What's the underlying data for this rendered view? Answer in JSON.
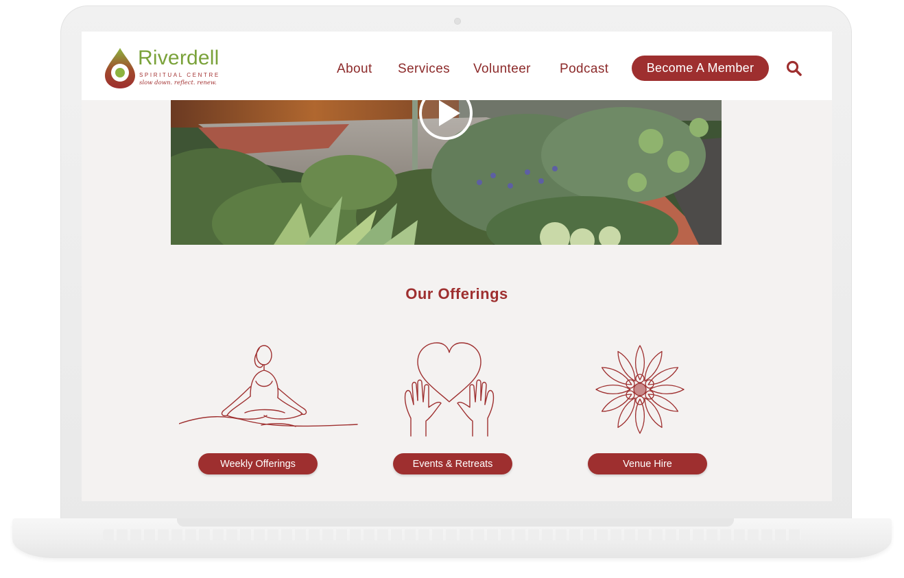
{
  "brand": {
    "name": "Riverdell",
    "subtitle": "SPIRITUAL CENTRE",
    "tagline": "slow down. reflect. renew."
  },
  "nav": {
    "items": [
      {
        "label": "About"
      },
      {
        "label": "Services"
      },
      {
        "label": "Volunteer"
      },
      {
        "label": "Podcast"
      }
    ],
    "cta_label": "Become A Member",
    "search_icon": "search-icon"
  },
  "hero": {
    "play_icon": "play-icon"
  },
  "offerings": {
    "title": "Our Offerings",
    "items": [
      {
        "label": "Weekly Offerings",
        "icon": "meditation-icon"
      },
      {
        "label": "Events & Retreats",
        "icon": "heart-hands-icon"
      },
      {
        "label": "Venue Hire",
        "icon": "flower-icon"
      }
    ]
  },
  "colors": {
    "primary": "#9e2f2f",
    "brand_green": "#7aa23a",
    "page_bg": "#f4f2f1"
  }
}
